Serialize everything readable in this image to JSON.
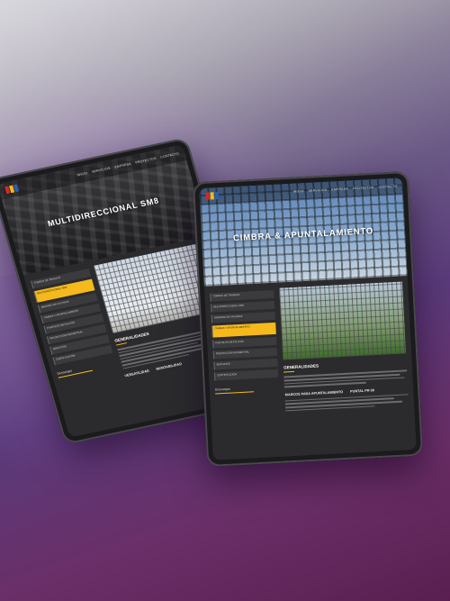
{
  "back_tablet": {
    "nav": [
      "INICIO",
      "SERVICIOS",
      "EMPRESA",
      "PROYECTOS",
      "CONTACTO"
    ],
    "hero_title": "MULTIDIRECCIONAL SM8",
    "menu": [
      "TORRES DE TRABAJO",
      "MULTIDIRECCIONAL SM8",
      "ANDAMIO DE FACHADA",
      "CIMBRA Y APUNTALAMIENTO",
      "PUNTALES METÁLICOS",
      "PROTECCIÓN PERIMETRAL",
      "SERVICIOS",
      "CERTIFICACIÓN"
    ],
    "active_index": 1,
    "descargas": "Descargas",
    "section_title": "GENERALIDADES",
    "sub_headings": [
      "VERSATILIDAD",
      "MONTABILIDAD"
    ]
  },
  "front_tablet": {
    "nav": [
      "INICIO",
      "SERVICIOS",
      "EMPRESA",
      "PROYECTOS",
      "CONTACTO"
    ],
    "hero_title": "CIMBRA & APUNTALAMIENTO",
    "menu": [
      "TORRES DE TRABAJO",
      "MULTIDIRECCIONAL SM8",
      "ANDAMIO DE FACHADA",
      "CIMBRA Y APUNTALAMIENTO",
      "PUNTALES METÁLICOS",
      "PROTECCIÓN PERIMETRAL",
      "SERVICIOS",
      "CERTIFICACIÓN"
    ],
    "active_index": 3,
    "descargas": "Descargas",
    "section_title": "GENERALIDADES",
    "sub_headings": [
      "MARCOS PARA APUNTALAMIENTO",
      "PUNTAL PR-30"
    ]
  },
  "colors": {
    "accent": "#f5b91c",
    "logo_red": "#d12a2a",
    "logo_blue": "#2b5fb5"
  }
}
